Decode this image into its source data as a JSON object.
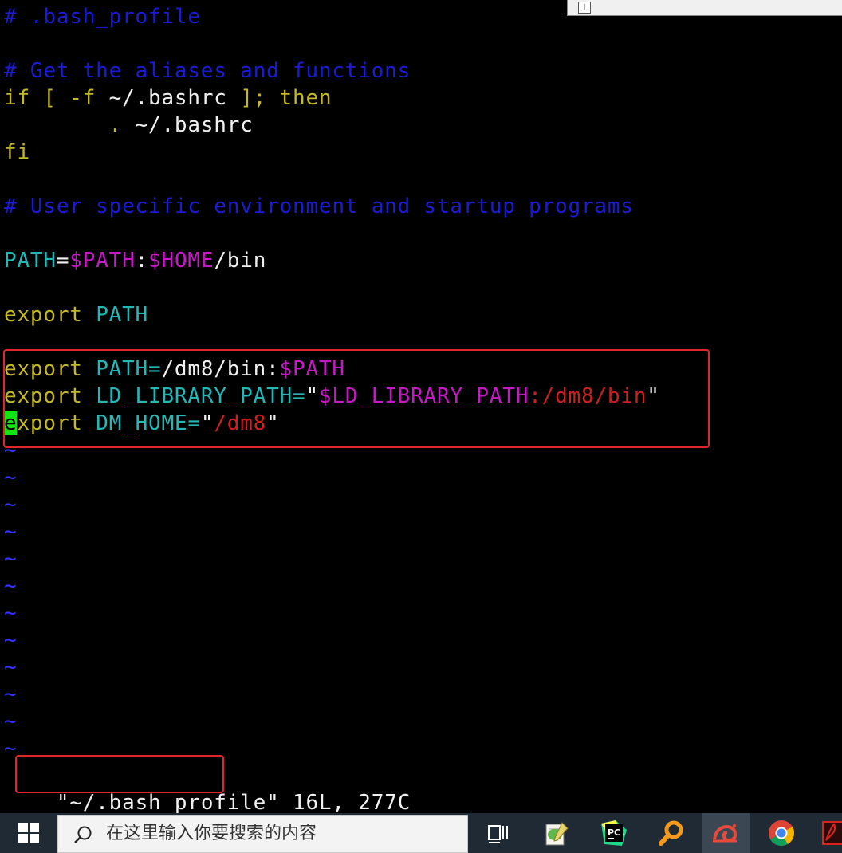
{
  "editor": {
    "lines": [
      [
        {
          "t": "# .bash_profile",
          "c": "blue"
        }
      ],
      [],
      [
        {
          "t": "# Get the aliases and functions",
          "c": "blue"
        }
      ],
      [
        {
          "t": "if [ -f ",
          "c": "yellow"
        },
        {
          "t": "~/.bashrc ",
          "c": "white"
        },
        {
          "t": "]; then",
          "c": "yellow"
        }
      ],
      [
        {
          "t": "        . ",
          "c": "yellow"
        },
        {
          "t": "~/.bashrc",
          "c": "white"
        }
      ],
      [
        {
          "t": "fi",
          "c": "yellow"
        }
      ],
      [],
      [
        {
          "t": "# User specific environment and startup programs",
          "c": "blue"
        }
      ],
      [],
      [
        {
          "t": "PATH",
          "c": "cyan"
        },
        {
          "t": "=",
          "c": "white"
        },
        {
          "t": "$PATH",
          "c": "magenta"
        },
        {
          "t": ":",
          "c": "white"
        },
        {
          "t": "$HOME",
          "c": "magenta"
        },
        {
          "t": "/bin",
          "c": "white"
        }
      ],
      [],
      [
        {
          "t": "export ",
          "c": "yellow"
        },
        {
          "t": "PATH",
          "c": "cyan"
        }
      ],
      [],
      [
        {
          "t": "export ",
          "c": "yellow"
        },
        {
          "t": "PATH=",
          "c": "cyan"
        },
        {
          "t": "/dm8/bin:",
          "c": "white"
        },
        {
          "t": "$PATH",
          "c": "magenta"
        }
      ],
      [
        {
          "t": "export ",
          "c": "yellow"
        },
        {
          "t": "LD_LIBRARY_PATH=",
          "c": "cyan"
        },
        {
          "t": "\"",
          "c": "white"
        },
        {
          "t": "$LD_LIBRARY_PATH",
          "c": "magenta"
        },
        {
          "t": ":/dm8/bin",
          "c": "red"
        },
        {
          "t": "\"",
          "c": "white"
        }
      ],
      [
        {
          "t": "e",
          "c": "cursor"
        },
        {
          "t": "xport ",
          "c": "yellow"
        },
        {
          "t": "DM_HOME=",
          "c": "cyan"
        },
        {
          "t": "\"",
          "c": "white"
        },
        {
          "t": "/dm8",
          "c": "red"
        },
        {
          "t": "\"",
          "c": "white"
        }
      ]
    ],
    "tilde_char": "~",
    "tilde_count": 12
  },
  "status_bar": {
    "quote_open": "\"",
    "filename": "~/.bash_profile",
    "rest": "\" 16L, 277C"
  },
  "window": {
    "pin_glyph": "⊥"
  },
  "taskbar": {
    "search_placeholder": "在这里输入你要搜索的内容",
    "apps": [
      {
        "name": "task-view-icon"
      },
      {
        "name": "notepad-plus-plus-icon"
      },
      {
        "name": "pycharm-icon",
        "label": "PC"
      },
      {
        "name": "search-tool-icon"
      },
      {
        "name": "snail-app-icon"
      },
      {
        "name": "chrome-icon"
      },
      {
        "name": "acrobat-icon"
      }
    ]
  },
  "colors": {
    "comment": "#1b1bd6",
    "keyword": "#c4b924",
    "variable": "#23b8b8",
    "expansion": "#c419c4",
    "string": "#d01f1f",
    "cursor": "#11e611",
    "highlight_box": "#e0262b"
  }
}
